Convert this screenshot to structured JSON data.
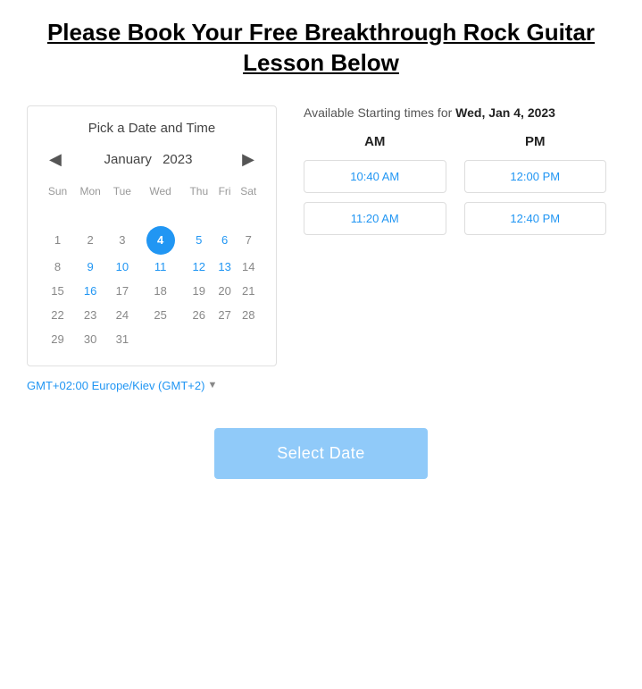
{
  "title": "Please Book Your Free Breakthrough Rock Guitar Lesson Below",
  "calendar": {
    "pick_label": "Pick a Date and Time",
    "month": "January",
    "year": "2023",
    "days_of_week": [
      "Sun",
      "Mon",
      "Tue",
      "Wed",
      "Thu",
      "Fri",
      "Sat"
    ],
    "weeks": [
      [
        null,
        null,
        null,
        null,
        null,
        null,
        null
      ],
      [
        1,
        2,
        3,
        4,
        5,
        6,
        7
      ],
      [
        8,
        9,
        10,
        11,
        12,
        13,
        14
      ],
      [
        15,
        16,
        17,
        18,
        19,
        20,
        21
      ],
      [
        22,
        23,
        24,
        25,
        26,
        27,
        28
      ],
      [
        29,
        30,
        31,
        null,
        null,
        null,
        null
      ]
    ],
    "selected_day": 4,
    "available_days": [
      4,
      5,
      6,
      9,
      10,
      11,
      12,
      13,
      16
    ]
  },
  "timeslots": {
    "available_label": "Available Starting times for",
    "selected_date": "Wed, Jan 4, 2023",
    "am_label": "AM",
    "pm_label": "PM",
    "am_slots": [
      "10:40 AM",
      "11:20 AM"
    ],
    "pm_slots": [
      "12:00 PM",
      "12:40 PM"
    ]
  },
  "timezone": {
    "label": "GMT+02:00 Europe/Kiev (GMT+2)"
  },
  "button": {
    "label": "Select Date"
  }
}
